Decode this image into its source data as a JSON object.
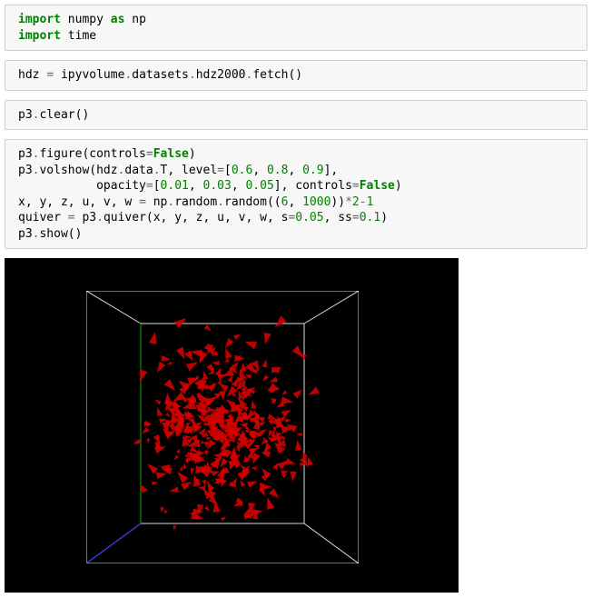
{
  "cells": [
    {
      "id": "cell-imports",
      "lines": [
        [
          {
            "t": "import",
            "c": "kw"
          },
          {
            "t": " numpy ",
            "c": "nm"
          },
          {
            "t": "as",
            "c": "kw"
          },
          {
            "t": " np",
            "c": "nm"
          }
        ],
        [
          {
            "t": "import",
            "c": "kw"
          },
          {
            "t": " time",
            "c": "nm"
          }
        ]
      ]
    },
    {
      "id": "cell-fetch",
      "lines": [
        [
          {
            "t": "hdz ",
            "c": "nm"
          },
          {
            "t": "=",
            "c": "op"
          },
          {
            "t": " ipyvolume",
            "c": "nm"
          },
          {
            "t": ".",
            "c": "op"
          },
          {
            "t": "datasets",
            "c": "nm"
          },
          {
            "t": ".",
            "c": "op"
          },
          {
            "t": "hdz2000",
            "c": "nm"
          },
          {
            "t": ".",
            "c": "op"
          },
          {
            "t": "fetch()",
            "c": "nm"
          }
        ]
      ]
    },
    {
      "id": "cell-clear",
      "lines": [
        [
          {
            "t": "p3",
            "c": "nm"
          },
          {
            "t": ".",
            "c": "op"
          },
          {
            "t": "clear()",
            "c": "nm"
          }
        ]
      ]
    },
    {
      "id": "cell-main",
      "lines": [
        [
          {
            "t": "p3",
            "c": "nm"
          },
          {
            "t": ".",
            "c": "op"
          },
          {
            "t": "figure(controls",
            "c": "nm"
          },
          {
            "t": "=",
            "c": "op"
          },
          {
            "t": "False",
            "c": "boolc"
          },
          {
            "t": ")",
            "c": "nm"
          }
        ],
        [
          {
            "t": "p3",
            "c": "nm"
          },
          {
            "t": ".",
            "c": "op"
          },
          {
            "t": "volshow(hdz",
            "c": "nm"
          },
          {
            "t": ".",
            "c": "op"
          },
          {
            "t": "data",
            "c": "nm"
          },
          {
            "t": ".",
            "c": "op"
          },
          {
            "t": "T, level",
            "c": "nm"
          },
          {
            "t": "=",
            "c": "op"
          },
          {
            "t": "[",
            "c": "nm"
          },
          {
            "t": "0.6",
            "c": "num"
          },
          {
            "t": ", ",
            "c": "nm"
          },
          {
            "t": "0.8",
            "c": "num"
          },
          {
            "t": ", ",
            "c": "nm"
          },
          {
            "t": "0.9",
            "c": "num"
          },
          {
            "t": "],",
            "c": "nm"
          }
        ],
        [
          {
            "t": "           opacity",
            "c": "nm"
          },
          {
            "t": "=",
            "c": "op"
          },
          {
            "t": "[",
            "c": "nm"
          },
          {
            "t": "0.01",
            "c": "num"
          },
          {
            "t": ", ",
            "c": "nm"
          },
          {
            "t": "0.03",
            "c": "num"
          },
          {
            "t": ", ",
            "c": "nm"
          },
          {
            "t": "0.05",
            "c": "num"
          },
          {
            "t": "], controls",
            "c": "nm"
          },
          {
            "t": "=",
            "c": "op"
          },
          {
            "t": "False",
            "c": "boolc"
          },
          {
            "t": ")",
            "c": "nm"
          }
        ],
        [
          {
            "t": "x, y, z, u, v, w ",
            "c": "nm"
          },
          {
            "t": "=",
            "c": "op"
          },
          {
            "t": " np",
            "c": "nm"
          },
          {
            "t": ".",
            "c": "op"
          },
          {
            "t": "random",
            "c": "nm"
          },
          {
            "t": ".",
            "c": "op"
          },
          {
            "t": "random((",
            "c": "nm"
          },
          {
            "t": "6",
            "c": "num"
          },
          {
            "t": ", ",
            "c": "nm"
          },
          {
            "t": "1000",
            "c": "num"
          },
          {
            "t": "))",
            "c": "nm"
          },
          {
            "t": "*",
            "c": "op"
          },
          {
            "t": "2",
            "c": "num"
          },
          {
            "t": "-",
            "c": "op"
          },
          {
            "t": "1",
            "c": "num"
          }
        ],
        [
          {
            "t": "quiver ",
            "c": "nm"
          },
          {
            "t": "=",
            "c": "op"
          },
          {
            "t": " p3",
            "c": "nm"
          },
          {
            "t": ".",
            "c": "op"
          },
          {
            "t": "quiver(x, y, z, u, v, w, s",
            "c": "nm"
          },
          {
            "t": "=",
            "c": "op"
          },
          {
            "t": "0.05",
            "c": "num"
          },
          {
            "t": ", ss",
            "c": "nm"
          },
          {
            "t": "=",
            "c": "op"
          },
          {
            "t": "0.1",
            "c": "num"
          },
          {
            "t": ")",
            "c": "nm"
          }
        ],
        [
          {
            "t": "p3",
            "c": "nm"
          },
          {
            "t": ".",
            "c": "op"
          },
          {
            "t": "show()",
            "c": "nm"
          }
        ]
      ]
    }
  ],
  "viz": {
    "bg": "#000000",
    "wire_color": "#dddddd",
    "particle_color": "#d40000",
    "particle_count": 400
  }
}
